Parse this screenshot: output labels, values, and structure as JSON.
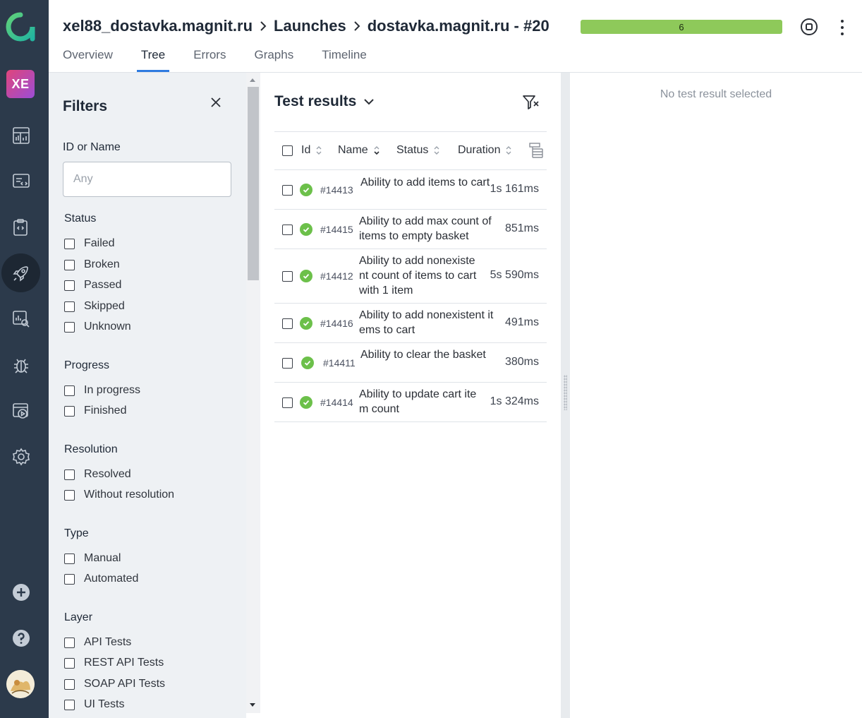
{
  "workspace": {
    "initials": "XE"
  },
  "header": {
    "breadcrumb": [
      "xel88_dostavka.magnit.ru",
      "Launches",
      "dostavka.magnit.ru - #20"
    ],
    "progress": {
      "label": "6",
      "passed_fraction": 1.0
    },
    "tabs": [
      {
        "label": "Overview",
        "active": false
      },
      {
        "label": "Tree",
        "active": true
      },
      {
        "label": "Errors",
        "active": false
      },
      {
        "label": "Graphs",
        "active": false
      },
      {
        "label": "Timeline",
        "active": false
      }
    ]
  },
  "nav": {
    "items": [
      "dashboards-icon",
      "test-cases-icon",
      "test-plans-icon",
      "launches-icon",
      "analytics-icon",
      "defects-icon",
      "jobs-icon",
      "settings-icon"
    ],
    "bottom": [
      "add-icon",
      "help-icon",
      "avatar"
    ]
  },
  "filters": {
    "title": "Filters",
    "id_or_name": {
      "label": "ID or Name",
      "placeholder": "Any",
      "value": ""
    },
    "status": {
      "title": "Status",
      "options": [
        "Failed",
        "Broken",
        "Passed",
        "Skipped",
        "Unknown"
      ]
    },
    "progress": {
      "title": "Progress",
      "options": [
        "In progress",
        "Finished"
      ]
    },
    "resolution": {
      "title": "Resolution",
      "options": [
        "Resolved",
        "Without resolution"
      ]
    },
    "type": {
      "title": "Type",
      "options": [
        "Manual",
        "Automated"
      ]
    },
    "layer": {
      "title": "Layer",
      "options": [
        "API Tests",
        "REST API Tests",
        "SOAP API Tests",
        "UI Tests"
      ]
    }
  },
  "results": {
    "title": "Test results",
    "columns": [
      "Id",
      "Name",
      "Status",
      "Duration"
    ],
    "rows": [
      {
        "id": "#14413",
        "name": "Ability to add items to cart",
        "status": "passed",
        "duration": "1s 161ms"
      },
      {
        "id": "#14415",
        "name": "Ability to add max count of items to empty basket",
        "status": "passed",
        "duration": "851ms"
      },
      {
        "id": "#14412",
        "name": "Ability to add nonexistent count of items to cart with 1 item",
        "status": "passed",
        "duration": "5s 590ms"
      },
      {
        "id": "#14416",
        "name": "Ability to add nonexistent items to cart",
        "status": "passed",
        "duration": "491ms"
      },
      {
        "id": "#14411",
        "name": "Ability to clear the basket",
        "status": "passed",
        "duration": "380ms"
      },
      {
        "id": "#14414",
        "name": "Ability to update cart item count",
        "status": "passed",
        "duration": "1s 324ms"
      }
    ]
  },
  "detail": {
    "empty_message": "No test result selected"
  },
  "colors": {
    "rail": "#2c3a4b",
    "progress_passed": "#8ec95a",
    "status_passed": "#6cc04a",
    "accent": "#2f7be0"
  }
}
